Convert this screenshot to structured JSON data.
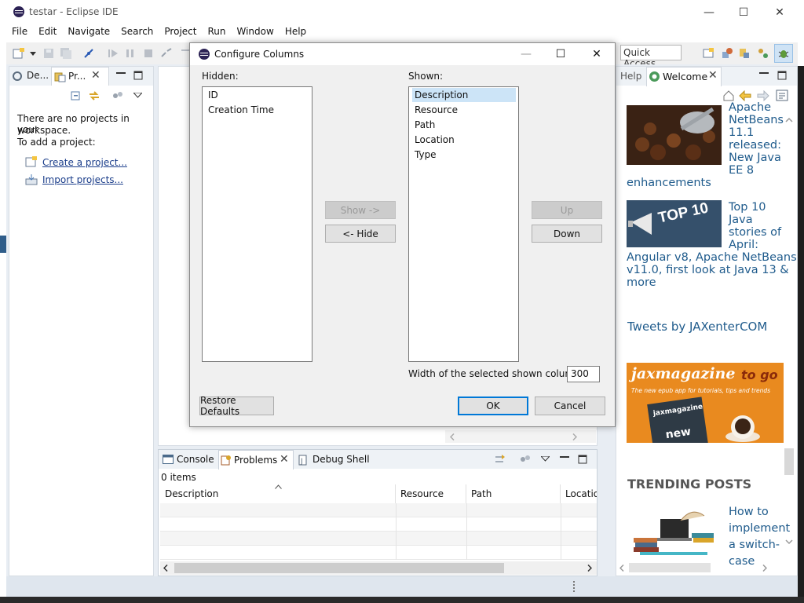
{
  "window": {
    "title": "testar - Eclipse IDE",
    "minimize": "—",
    "maximize": "☐",
    "close": "✕"
  },
  "menu": [
    "File",
    "Edit",
    "Navigate",
    "Search",
    "Project",
    "Run",
    "Window",
    "Help"
  ],
  "toolbar": {
    "quick_access": "Quick Access"
  },
  "left_panel": {
    "tabs": [
      "De...",
      "Pr..."
    ],
    "empty_line1": "There are no projects in your",
    "empty_line2": "workspace.",
    "empty_line3": "To add a project:",
    "create_link": "Create a project...",
    "import_link": "Import projects..."
  },
  "dialog": {
    "title": "Configure Columns",
    "hidden_label": "Hidden:",
    "shown_label": "Shown:",
    "hidden_items": [
      "ID",
      "Creation Time"
    ],
    "shown_items": [
      "Description",
      "Resource",
      "Path",
      "Location",
      "Type"
    ],
    "show_button": "Show ->",
    "hide_button": "<- Hide",
    "up_button": "Up",
    "down_button": "Down",
    "width_label": "Width of the selected shown column:",
    "width_value": "300",
    "restore_button": "Restore Defaults",
    "ok_button": "OK",
    "cancel_button": "Cancel"
  },
  "problems_view": {
    "tabs": [
      "Console",
      "Problems",
      "Debug Shell"
    ],
    "items_count": "0 items",
    "columns": [
      "Description",
      "Resource",
      "Path",
      "Locatio"
    ]
  },
  "right_panel": {
    "tabs": [
      "Help",
      "Welcome"
    ],
    "news1": [
      "Apache",
      "NetBeans",
      "11.1",
      "released:",
      "New Java",
      "EE 8",
      "enhancements"
    ],
    "news2": [
      "Top 10",
      "Java",
      "stories of",
      "April:",
      "Angular v8, Apache NetBeans",
      "v11.0, first look at Java 13 &",
      "more"
    ],
    "tweets": "Tweets by JAXenterCOM",
    "trending": "TRENDING POSTS",
    "news3": [
      "How to",
      "implement",
      "a switch-",
      "case"
    ],
    "top10_badge": "TOP 10",
    "jax_brand": "jaxmagazine",
    "jax_togo": "to go",
    "jax_sub": "The new epub app for tutorials, tips and trends",
    "jax_tablet": "jaxmagazine",
    "jax_new": "new"
  }
}
